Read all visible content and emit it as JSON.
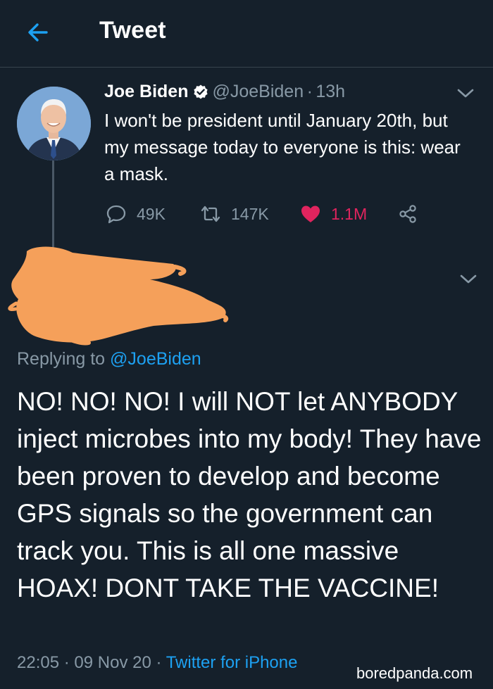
{
  "header": {
    "title": "Tweet",
    "back_icon": "arrow-left-icon"
  },
  "tweet": {
    "author_name": "Joe Biden",
    "verified": true,
    "handle": "@JoeBiden",
    "separator": "·",
    "time": "13h",
    "text": "I won't be president until January 20th, but my message today to everyone is this: wear a mask.",
    "actions": {
      "replies": "49K",
      "retweets": "147K",
      "likes": "1.1M",
      "liked": true
    }
  },
  "reply": {
    "author_redacted": true,
    "replying_prefix": "Replying to ",
    "replying_handle": "@JoeBiden",
    "text": "NO! NO! NO! I will NOT let ANYBODY inject microbes into my body! They have been proven to develop and become GPS signals so the government can track you. This is all one massive HOAX! DONT TAKE THE VACCINE!",
    "time": "22:05",
    "separator1": "·",
    "date": "09 Nov 20",
    "separator2": "·",
    "source": "Twitter for iPhone"
  },
  "watermark": "boredpanda.com",
  "colors": {
    "background": "#15202b",
    "accent": "#1da1f2",
    "secondary_text": "#8899a6",
    "like": "#e0245e",
    "redaction": "#f5a05a"
  }
}
